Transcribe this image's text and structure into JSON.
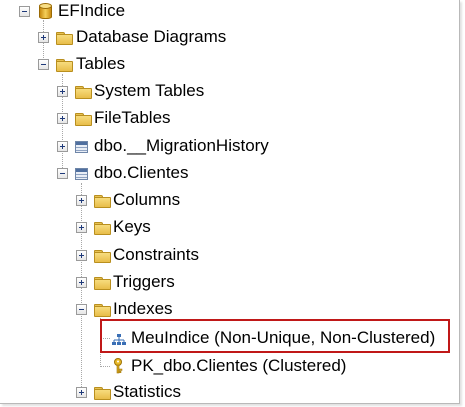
{
  "tree": {
    "root": {
      "label": "EFIndice",
      "icon": "database-icon"
    },
    "database_diagrams": {
      "label": "Database Diagrams"
    },
    "tables": {
      "label": "Tables"
    },
    "system_tables": {
      "label": "System Tables"
    },
    "file_tables": {
      "label": "FileTables"
    },
    "migration_history": {
      "label": "dbo.__MigrationHistory"
    },
    "clientes": {
      "label": "dbo.Clientes"
    },
    "columns": {
      "label": "Columns"
    },
    "keys": {
      "label": "Keys"
    },
    "constraints": {
      "label": "Constraints"
    },
    "triggers": {
      "label": "Triggers"
    },
    "indexes": {
      "label": "Indexes"
    },
    "index_meuindice": {
      "label": "MeuIndice (Non-Unique, Non-Clustered)"
    },
    "index_pk": {
      "label": "PK_dbo.Clientes (Clustered)"
    },
    "statistics": {
      "label": "Statistics"
    }
  },
  "highlight_color": "#c01818"
}
